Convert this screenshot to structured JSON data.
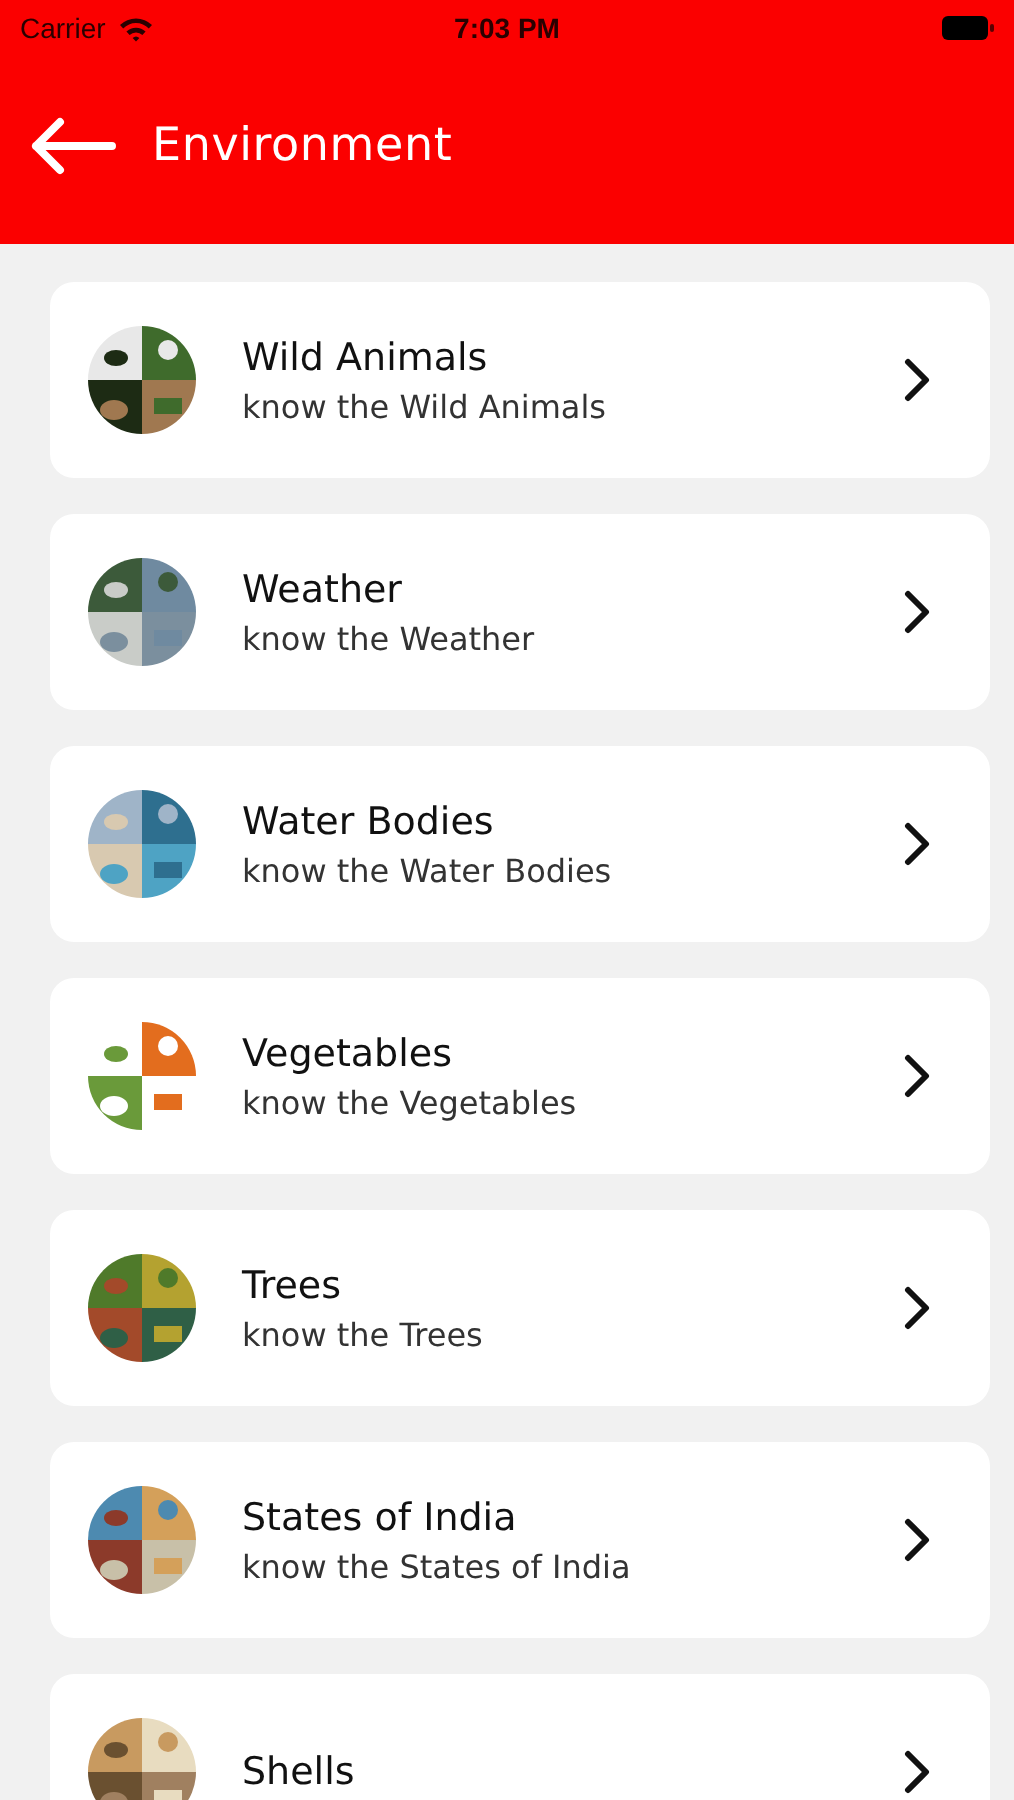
{
  "status_bar": {
    "carrier": "Carrier",
    "time": "7:03 PM"
  },
  "header": {
    "title": "Environment"
  },
  "items": [
    {
      "title": "Wild Animals",
      "subtitle": "know the Wild Animals"
    },
    {
      "title": "Weather",
      "subtitle": "know the Weather"
    },
    {
      "title": "Water Bodies",
      "subtitle": "know the Water Bodies"
    },
    {
      "title": "Vegetables",
      "subtitle": "know the Vegetables"
    },
    {
      "title": "Trees",
      "subtitle": "know the Trees"
    },
    {
      "title": "States of India",
      "subtitle": "know the States of India"
    },
    {
      "title": "Shells"
    }
  ]
}
